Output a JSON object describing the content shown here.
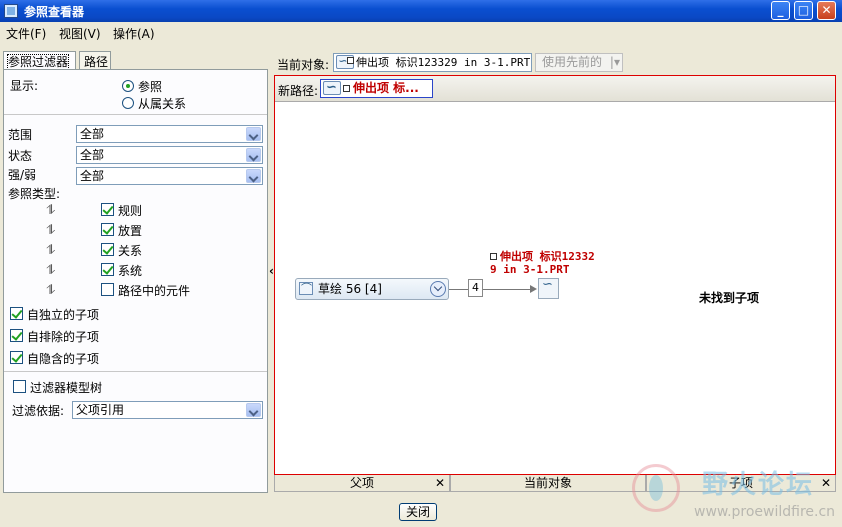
{
  "window": {
    "title": "参照查看器"
  },
  "menu": [
    "文件(F)",
    "视图(V)",
    "操作(A)"
  ],
  "left": {
    "tabs": [
      "参照过滤器",
      "路径"
    ],
    "display_label": "显示:",
    "display_options": [
      "参照",
      "从属关系"
    ],
    "scope_label": "范围",
    "scope_value": "全部",
    "status_label": "状态",
    "status_value": "全部",
    "strength_label": "强/弱",
    "strength_value": "全部",
    "ref_type_label": "参照类型:",
    "ref_types": [
      {
        "label": "规则",
        "checked": true
      },
      {
        "label": "放置",
        "checked": true
      },
      {
        "label": "关系",
        "checked": true
      },
      {
        "label": "系统",
        "checked": true
      },
      {
        "label": "路径中的元件",
        "checked": false
      }
    ],
    "child_options": [
      {
        "label": "自独立的子项",
        "checked": true
      },
      {
        "label": "自排除的子项",
        "checked": true
      },
      {
        "label": "自隐含的子项",
        "checked": true
      }
    ],
    "filter_model_tree": {
      "label": "过滤器模型树",
      "checked": false
    },
    "filter_by_label": "过滤依据:",
    "filter_by_value": "父项引用"
  },
  "top": {
    "current_object_label": "当前对象:",
    "current_object_value": "伸出项 标识123329 in 3-1.PRT",
    "use_previous": "使用先前的"
  },
  "graph": {
    "new_path_label": "新路径:",
    "new_path_chip": "伸出项 标...",
    "parent_node": "草绘 56 [4]",
    "count": "4",
    "current_line1": "伸出项 标识12332",
    "current_line2": "9 in 3-1.PRT",
    "no_child": "未找到子项"
  },
  "columns": [
    "父项",
    "当前对象",
    "子项"
  ],
  "close_button": "关闭",
  "watermark": {
    "title": "野火论坛",
    "url": "www.proewildfire.cn"
  }
}
